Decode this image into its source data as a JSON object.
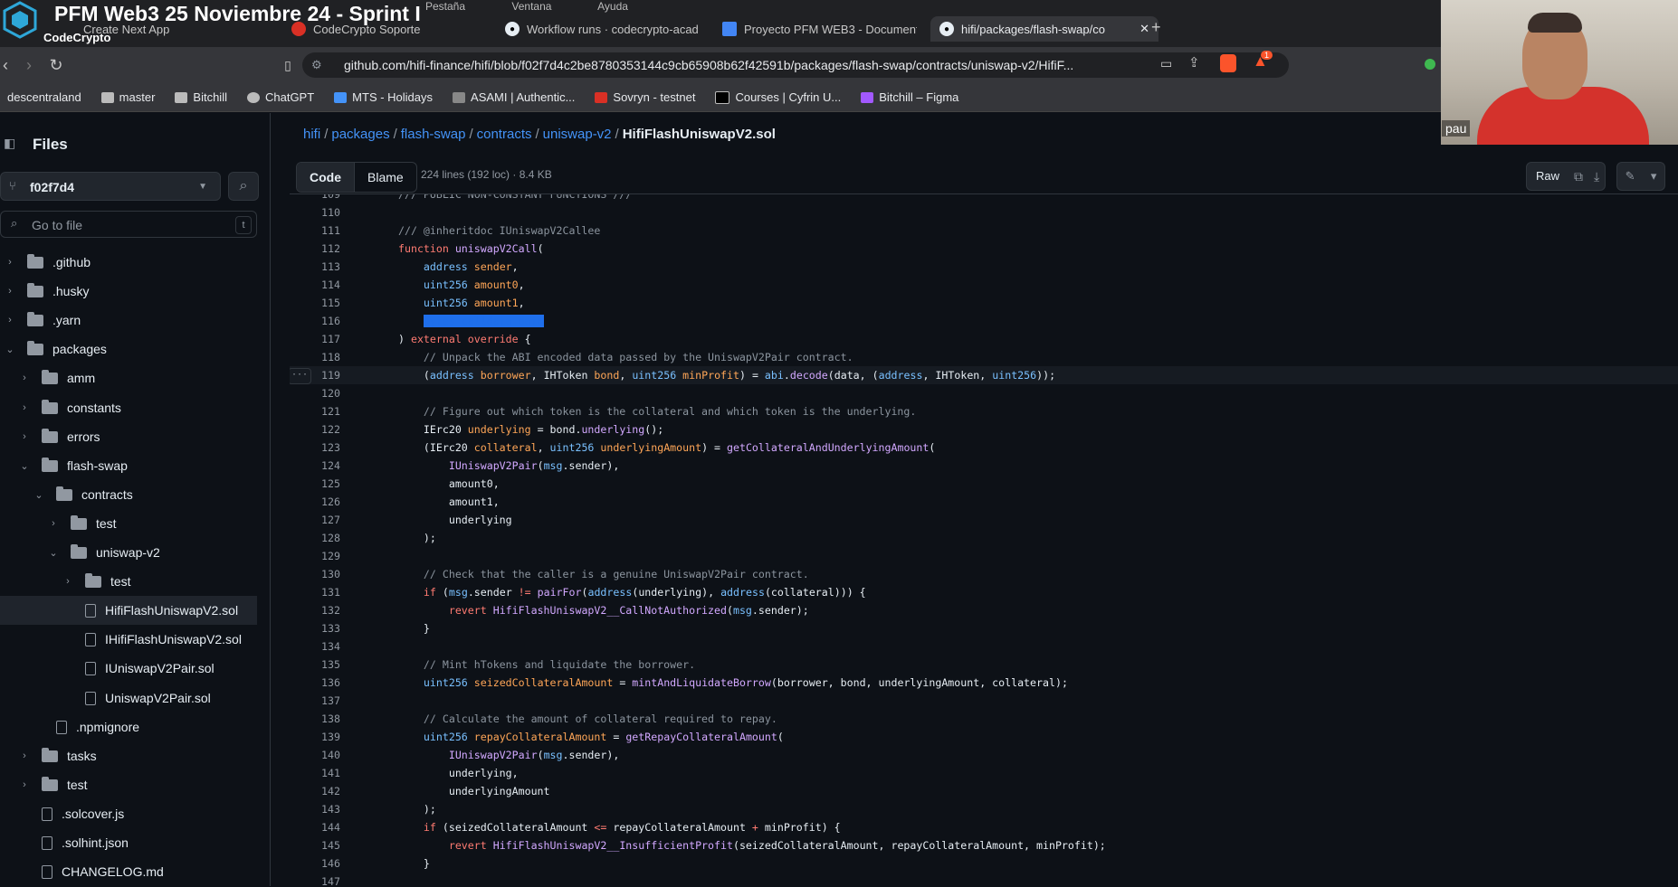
{
  "stream": {
    "title": "PFM Web3 25 Noviembre 24 - Sprint I",
    "brand": "CodeCrypto",
    "participant": "pau"
  },
  "os_menu": [
    "Pestaña",
    "Ventana",
    "Ayuda"
  ],
  "tabs": [
    {
      "label": "Create Next App",
      "active": false
    },
    {
      "label": "CodeCrypto Soporte",
      "active": false
    },
    {
      "label": "Workflow runs · codecrypto-acad",
      "active": false
    },
    {
      "label": "Proyecto PFM WEB3 - Document",
      "active": false
    },
    {
      "label": "hifi/packages/flash-swap/co",
      "active": true
    }
  ],
  "address_bar": {
    "url": "github.com/hifi-finance/hifi/blob/f02f7d4c2be8780353144c9cb65908b62f42591b/packages/flash-swap/contracts/uniswap-v2/HifiF...",
    "notification_count": "1"
  },
  "bookmarks": [
    "descentraland",
    "master",
    "Bitchill",
    "ChatGPT",
    "MTS - Holidays",
    "ASAMI | Authentic...",
    "Sovryn - testnet",
    "Courses | Cyfrin U...",
    "Bitchill – Figma"
  ],
  "sidebar": {
    "title": "Files",
    "branch": "f02f7d4",
    "goto_placeholder": "Go to file",
    "goto_shortcut": "t",
    "tree": [
      {
        "label": ".github",
        "type": "folder",
        "depth": 0,
        "expanded": false
      },
      {
        "label": ".husky",
        "type": "folder",
        "depth": 0,
        "expanded": false
      },
      {
        "label": ".yarn",
        "type": "folder",
        "depth": 0,
        "expanded": false
      },
      {
        "label": "packages",
        "type": "folder",
        "depth": 0,
        "expanded": true
      },
      {
        "label": "amm",
        "type": "folder",
        "depth": 1,
        "expanded": false
      },
      {
        "label": "constants",
        "type": "folder",
        "depth": 1,
        "expanded": false
      },
      {
        "label": "errors",
        "type": "folder",
        "depth": 1,
        "expanded": false
      },
      {
        "label": "flash-swap",
        "type": "folder",
        "depth": 1,
        "expanded": true
      },
      {
        "label": "contracts",
        "type": "folder",
        "depth": 2,
        "expanded": true
      },
      {
        "label": "test",
        "type": "folder",
        "depth": 3,
        "expanded": false
      },
      {
        "label": "uniswap-v2",
        "type": "folder",
        "depth": 3,
        "expanded": true
      },
      {
        "label": "test",
        "type": "folder",
        "depth": 4,
        "expanded": false
      },
      {
        "label": "HifiFlashUniswapV2.sol",
        "type": "file",
        "depth": 4,
        "selected": true
      },
      {
        "label": "IHifiFlashUniswapV2.sol",
        "type": "file",
        "depth": 4
      },
      {
        "label": "IUniswapV2Pair.sol",
        "type": "file",
        "depth": 4
      },
      {
        "label": "UniswapV2Pair.sol",
        "type": "file",
        "depth": 4
      },
      {
        "label": ".npmignore",
        "type": "file",
        "depth": 2
      },
      {
        "label": "tasks",
        "type": "folder",
        "depth": 1,
        "expanded": false
      },
      {
        "label": "test",
        "type": "folder",
        "depth": 1,
        "expanded": false
      },
      {
        "label": ".solcover.js",
        "type": "file",
        "depth": 1
      },
      {
        "label": ".solhint.json",
        "type": "file",
        "depth": 1
      },
      {
        "label": "CHANGELOG.md",
        "type": "file",
        "depth": 1
      }
    ]
  },
  "breadcrumb": [
    "hifi",
    "packages",
    "flash-swap",
    "contracts",
    "uniswap-v2"
  ],
  "current_file": "HifiFlashUniswapV2.sol",
  "view_tabs": {
    "code": "Code",
    "blame": "Blame"
  },
  "file_meta": "224 lines (192 loc) · 8.4 KB",
  "raw_label": "Raw",
  "code": {
    "first_line": 109,
    "highlighted_line": 119,
    "selection": "bytes calldata data"
  }
}
